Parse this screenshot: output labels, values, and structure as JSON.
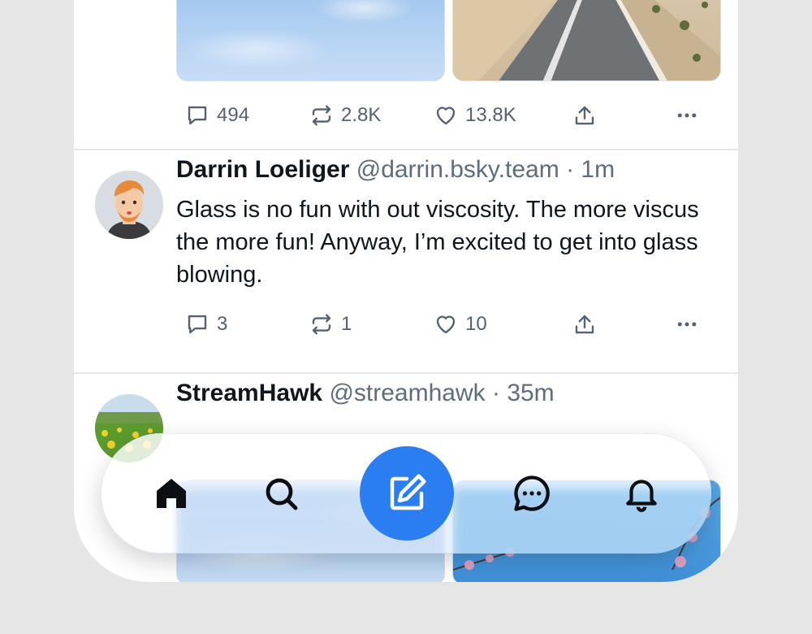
{
  "post_top": {
    "actions": {
      "replies": "494",
      "reposts": "2.8K",
      "likes": "13.8K"
    }
  },
  "post_darrin": {
    "name": "Darrin Loeliger",
    "handle": "@darrin.bsky.team",
    "separator": "·",
    "time": "1m",
    "text": "Glass is no fun with out viscosity. The more viscus the more fun! Anyway, I’m excited to get into glass blowing.",
    "actions": {
      "replies": "3",
      "reposts": "1",
      "likes": "10"
    }
  },
  "post_streamhawk": {
    "name": "StreamHawk",
    "handle": "@streamhawk",
    "separator": "·",
    "time": "35m"
  },
  "nav": {
    "items": [
      "home-icon",
      "search-icon",
      "compose-icon",
      "chat-icon",
      "bell-icon"
    ],
    "accent": "#2b7df2"
  },
  "colors": {
    "text_primary": "#10161d",
    "text_secondary": "#526272",
    "divider": "#e3e9ef",
    "background": "#e6e6e6"
  }
}
